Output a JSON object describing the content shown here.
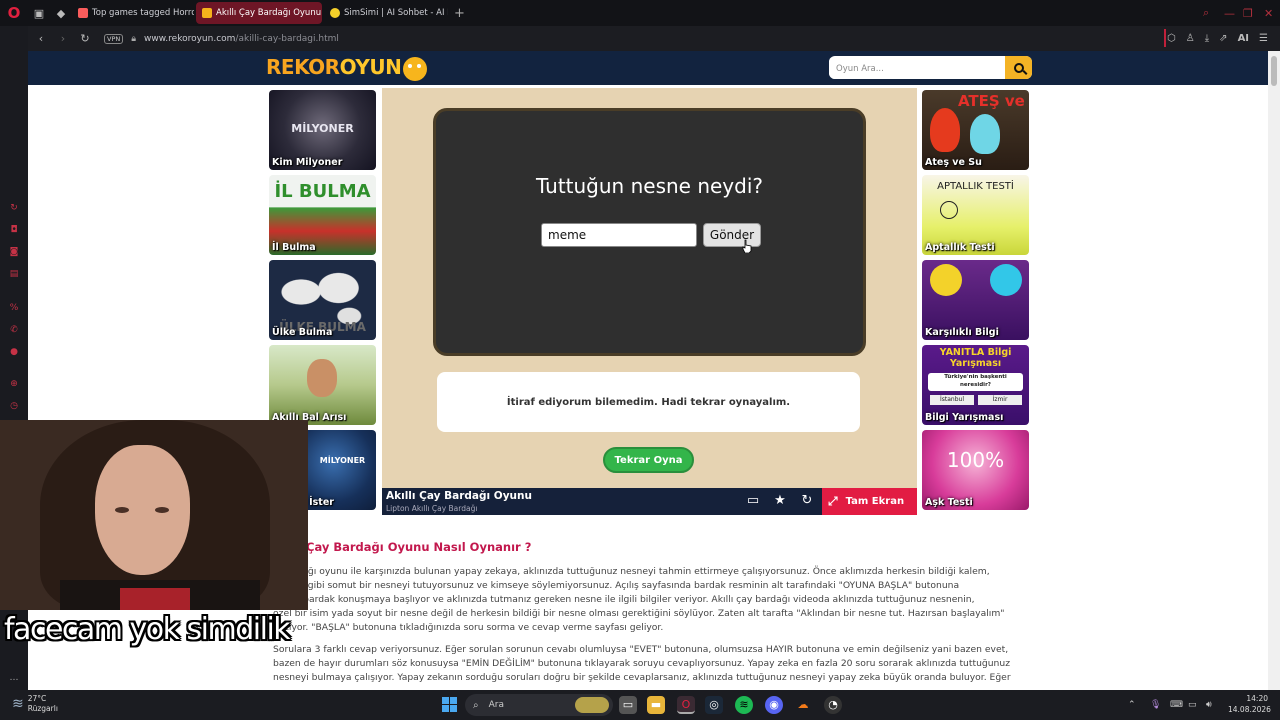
{
  "browser": {
    "tabs": [
      {
        "label": "Top games tagged Horror",
        "fav_color": "#fa5c5c",
        "active": false
      },
      {
        "label": "Akıllı Çay Bardağı Oyunu O",
        "fav_color": "#f6b31c",
        "active": true
      },
      {
        "label": "SimSimi | AI Sohbet - AI Ka",
        "fav_color": "#f5d02a",
        "active": false
      }
    ],
    "vpn_label": "VPN",
    "url_host": "www.rekoroyun.com",
    "url_path": "/akilli-cay-bardagi.html",
    "ai_label": "AI"
  },
  "site": {
    "logo_rekor": "REKOR",
    "logo_oyun": "OYUN",
    "search_placeholder": "Oyun Ara..."
  },
  "left_games": [
    {
      "label": "Kim Milyoner",
      "art": "MİLYONER"
    },
    {
      "label": "İl Bulma",
      "art": "İL BULMA"
    },
    {
      "label": "Ülke Bulma",
      "art": "ÜLKE BULMA"
    },
    {
      "label": "Akıllı Bal Arısı",
      "art": ""
    },
    {
      "label": "10 Bin İster",
      "art": "MİLYONER"
    }
  ],
  "right_games": [
    {
      "label": "Ateş ve Su",
      "art": "ATEŞ ve SU"
    },
    {
      "label": "Aptallık Testi",
      "art": "APTALLIK TESTİ"
    },
    {
      "label": "Karşılıklı Bilgi",
      "art": ""
    },
    {
      "label": "Bilgi Yarışması",
      "art": "YANITLA Bilgi Yarışması",
      "question": "Türkiye'nin başkenti neresidir?",
      "opt1": "İstanbul",
      "opt2": "İzmir"
    },
    {
      "label": "Aşk Testi",
      "art": "100%"
    }
  ],
  "game": {
    "question": "Tuttuğun nesne neydi?",
    "answer_value": "meme",
    "send_label": "Gönder",
    "result_text": "İtiraf ediyorum bilemedim. Hadi tekrar oynayalım.",
    "replay_label": "Tekrar Oyna",
    "title": "Akıllı Çay Bardağı Oyunu",
    "subtitle": "Lipton Akıllı Çay Bardağı",
    "fullscreen_label": "Tam Ekran"
  },
  "description": {
    "heading": "Çay Bardağı Oyunu Nasıl Oynanır ?",
    "p1_l1": "y bardağı oyunu ile karşınızda bulunan yapay zekaya, aklınızda tuttuğunuz nesneyi tahmin ettirmeye çalışıyorsunuz. Önce aklımızda herkesin bildiği kalem,",
    "p1_l2": "bardak gibi somut bir nesneyi tutuyorsunuz ve kimseye söylemiyorsunuz. Açılış sayfasında bardak resminin alt tarafındaki \"OYUNA BAŞLA\" butonuna",
    "p1_l3": "ınızda bardak konuşmaya başlıyor ve aklınızda tutmanız gereken nesne ile ilgili bilgiler veriyor. Akıllı çay bardağı videoda aklınızda tuttuğunuz nesnenin,",
    "p1_l4": "özel bir isim yada soyut bir nesne değil de herkesin bildiği bir nesne olması gerektiğini söylüyor. Zaten alt tarafta \"Aklından bir nesne tut. Hazırsan başlayalım\"",
    "p1_l5": "yazıyor. \"BAŞLA\" butonuna tıkladığınızda soru sorma ve cevap verme sayfası geliyor.",
    "p2_l1": "Sorulara 3 farklı cevap veriyorsunuz. Eğer sorulan sorunun cevabı olumluysa \"EVET\" butonuna, olumsuzsa HAYIR butonuna ve emin değilseniz yani bazen evet,",
    "p2_l2": "bazen de hayır durumları söz konusuysa \"EMİN DEĞİLİM\" butonuna tıklayarak soruyu cevaplıyorsunuz. Yapay zeka en fazla 20 soru sorarak aklınızda tuttuğunuz",
    "p2_l3": "nesneyi bulmaya çalışıyor. Yapay zekanın sorduğu soruları doğru bir şekilde cevaplarsanız, aklınızda tuttuğunuz nesneyi yapay zeka büyük oranda buluyor. Eğer"
  },
  "overlay": {
    "caption": "facecam yok simdilik"
  },
  "taskbar": {
    "temp": "27°C",
    "weather_label": "Rüzgarlı",
    "search_label": "Ara",
    "time": "14:20",
    "date": "14.08.2026"
  },
  "colors": {
    "accent": "#e21c43",
    "header_bg": "#12233f",
    "replay_green": "#33b54a",
    "heading_pink": "#c2184d"
  }
}
